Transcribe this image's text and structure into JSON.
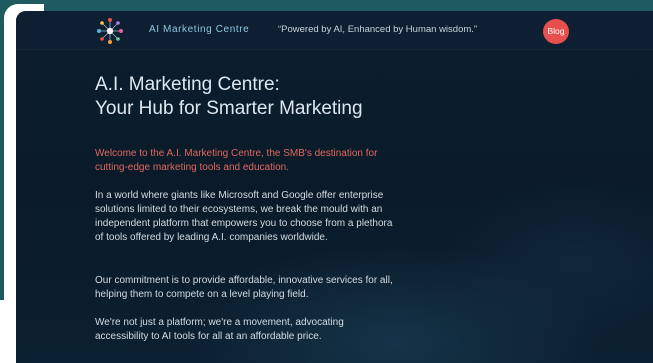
{
  "header": {
    "brand": "AI Marketing Centre",
    "tagline": "“Powered by AI, Enhanced by Human wisdom.”",
    "blog_label": "Blog",
    "logo_icon": "network-logo-icon"
  },
  "hero": {
    "title_line1": "A.I. Marketing Centre:",
    "title_line2": "Your Hub for Smarter Marketing"
  },
  "content": {
    "intro": "Welcome to the A.I. Marketing Centre, the SMB's destination for cutting-edge marketing tools and education.",
    "paragraph1": "In a world where giants like Microsoft and Google offer enterprise solutions limited to their ecosystems, we break the mould with an independent platform that empowers you to choose from a plethora of tools offered by leading A.I. companies worldwide.",
    "paragraph2": "Our commitment is to provide affordable, innovative services for all, helping them to compete on a level playing field.",
    "paragraph3": "We're not just a platform; we're a movement, advocating accessibility to AI tools for all at an affordable price."
  },
  "colors": {
    "accent_red": "#e8504f",
    "intro_text": "#e0685e",
    "brand_text": "#8fc7e4",
    "background": "#0c1e2e"
  }
}
